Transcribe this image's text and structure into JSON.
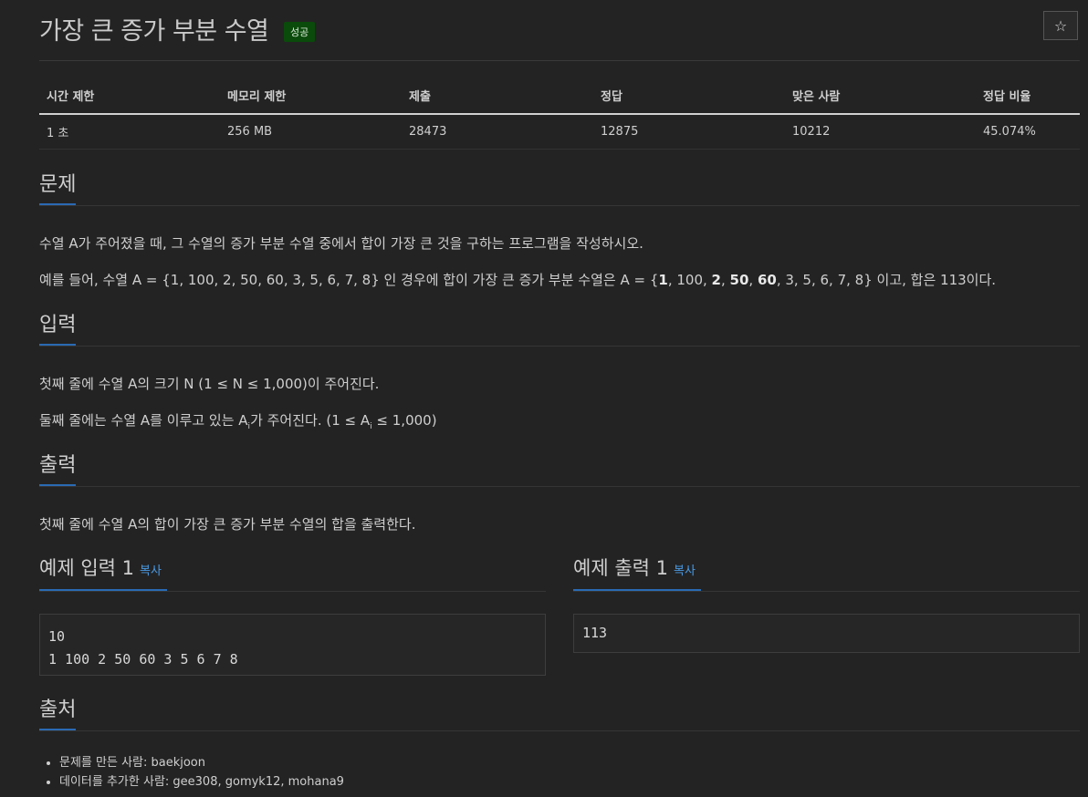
{
  "problem": {
    "title": "가장 큰 증가 부분 수열",
    "status_badge": "성공",
    "star_icon": "☆"
  },
  "stats": {
    "headers": [
      "시간 제한",
      "메모리 제한",
      "제출",
      "정답",
      "맞은 사람",
      "정답 비율"
    ],
    "values": [
      "1 초",
      "256 MB",
      "28473",
      "12875",
      "10212",
      "45.074%"
    ]
  },
  "sections": {
    "problem_label": "문제",
    "problem_p1": "수열 A가 주어졌을 때, 그 수열의 증가 부분 수열 중에서 합이 가장 큰 것을 구하는 프로그램을 작성하시오.",
    "problem_p2_prefix": "예를 들어, 수열 A = {1, 100, 2, 50, 60, 3, 5, 6, 7, 8} 인 경우에 합이 가장 큰 증가 부분 수열은 A = {",
    "problem_p2_b1": "1",
    "problem_p2_m1": ", 100, ",
    "problem_p2_b2": "2",
    "problem_p2_m2": ", ",
    "problem_p2_b3": "50",
    "problem_p2_m3": ", ",
    "problem_p2_b4": "60",
    "problem_p2_suffix": ", 3, 5, 6, 7, 8} 이고, 합은 113이다.",
    "input_label": "입력",
    "input_p1": "첫째 줄에 수열 A의 크기 N (1 ≤ N ≤ 1,000)이 주어진다.",
    "input_p2_prefix": "둘째 줄에는 수열 A를 이루고 있는 A",
    "input_p2_sub": "i",
    "input_p2_mid": "가 주어진다. (1 ≤ A",
    "input_p2_sub2": "i",
    "input_p2_suffix": " ≤ 1,000)",
    "output_label": "출력",
    "output_p1": "첫째 줄에 수열 A의 합이 가장 큰 증가 부분 수열의 합을 출력한다.",
    "source_label": "출처"
  },
  "examples": {
    "input_title": "예제 입력 1",
    "output_title": "예제 출력 1",
    "copy_label": "복사",
    "input_text": "10\n1 100 2 50 60 3 5 6 7 8",
    "output_text": "113"
  },
  "source": {
    "items": [
      "문제를 만든 사람: baekjoon",
      "데이터를 추가한 사람: gee308, gomyk12, mohana9"
    ]
  }
}
